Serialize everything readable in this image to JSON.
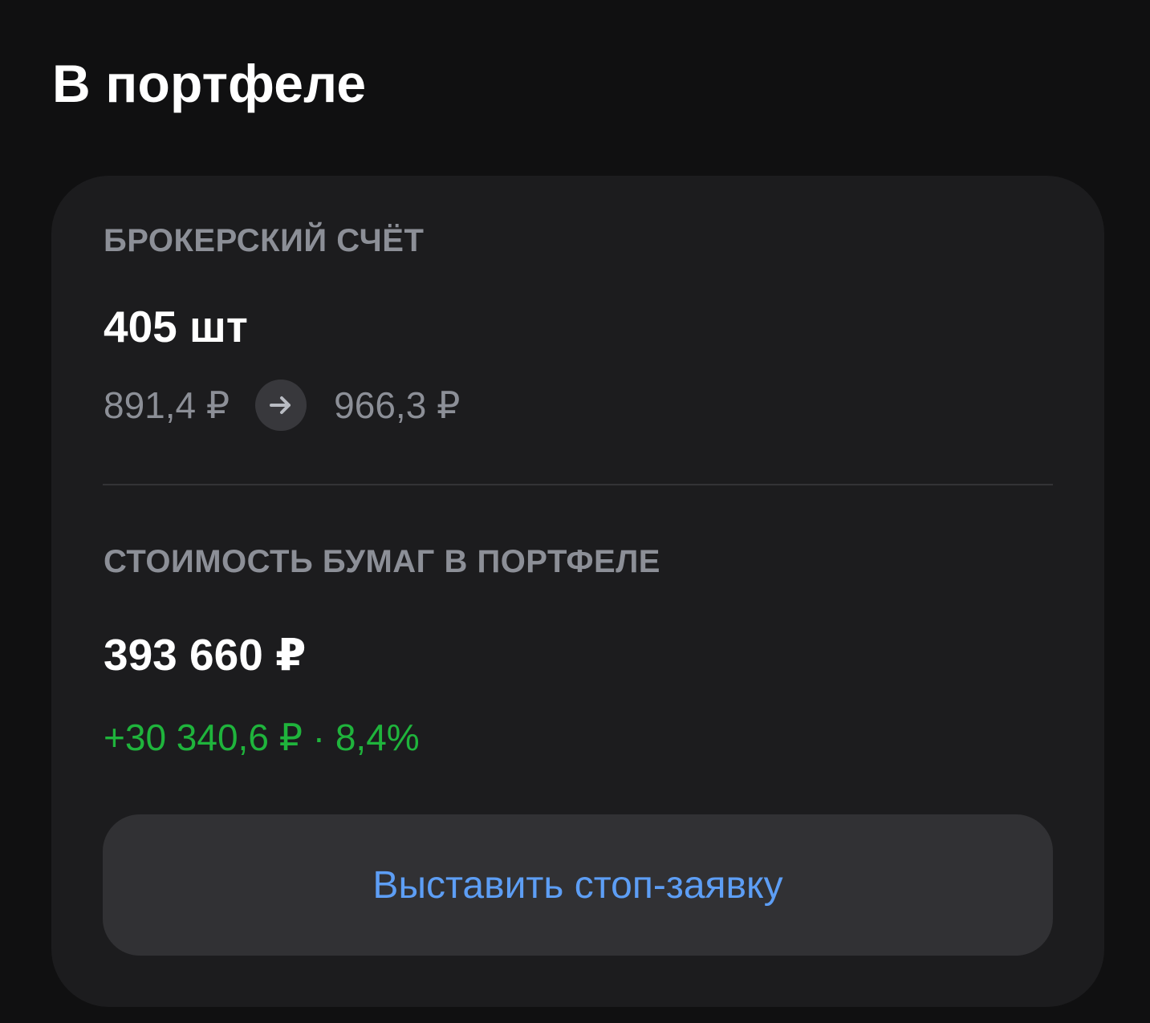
{
  "header": {
    "title": "В портфеле"
  },
  "brokerage": {
    "label": "БРОКЕРСКИЙ СЧЁТ",
    "quantity": "405 шт",
    "price_from": "891,4 ₽",
    "price_to": "966,3 ₽",
    "arrow_icon": "arrow-right-icon"
  },
  "portfolio": {
    "label": "СТОИМОСТЬ БУМАГ В ПОРТФЕЛЕ",
    "value": "393 660 ₽",
    "change": "+30 340,6 ₽ · 8,4%"
  },
  "actions": {
    "stop_order_label": "Выставить стоп-заявку"
  },
  "colors": {
    "background": "#101011",
    "card": "#1c1c1e",
    "secondary_text": "#8c8f97",
    "positive": "#1fb43c",
    "accent": "#5d9ef5",
    "button": "#313134"
  }
}
